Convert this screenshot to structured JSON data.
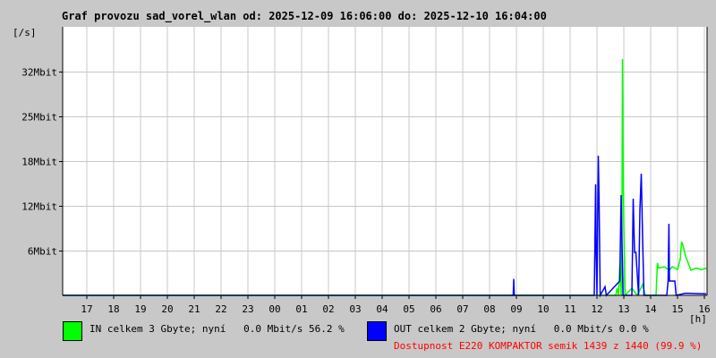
{
  "title": "Graf provozu sad_vorel_wlan od: 2025-12-09 16:06:00 do: 2025-12-10 16:04:00",
  "legend": {
    "in_text": "IN celkem 3 Gbyte; nyní   0.0 Mbit/s 56.2 %",
    "out_text": "OUT celkem 2 Gbyte; nyní   0.0 Mbit/s 0.0 %",
    "availability": "Dostupnost E220 KOMPAKTOR semik 1439 z 1440 (99.9 %)"
  },
  "colors": {
    "in": "#00ff00",
    "out": "#0000ff",
    "availability": "#ff0000",
    "grid": "#c8c8c8"
  },
  "chart_data": {
    "type": "line",
    "ylabel": "[/s]",
    "xlabel": "[h]",
    "ylim": [
      0,
      37.5
    ],
    "yticks": [
      {
        "v": 6.25,
        "label": "6Mbit"
      },
      {
        "v": 12.5,
        "label": "12Mbit"
      },
      {
        "v": 18.75,
        "label": "18Mbit"
      },
      {
        "v": 25,
        "label": "25Mbit"
      },
      {
        "v": 31.25,
        "label": "32Mbit"
      }
    ],
    "xlim": [
      16.1,
      40.07
    ],
    "xticks": [
      "17",
      "18",
      "19",
      "20",
      "21",
      "22",
      "23",
      "00",
      "01",
      "02",
      "03",
      "04",
      "05",
      "06",
      "07",
      "08",
      "09",
      "10",
      "11",
      "12",
      "13",
      "14",
      "15",
      "16"
    ],
    "series": [
      {
        "name": "IN",
        "color": "#00ff00",
        "points": [
          [
            36.5,
            0
          ],
          [
            36.7,
            0
          ],
          [
            36.75,
            1
          ],
          [
            36.8,
            0
          ],
          [
            36.85,
            4
          ],
          [
            36.9,
            0
          ],
          [
            36.93,
            9
          ],
          [
            36.95,
            33
          ],
          [
            36.97,
            20
          ],
          [
            37.0,
            10
          ],
          [
            37.05,
            0
          ],
          [
            37.3,
            1
          ],
          [
            37.5,
            0
          ],
          [
            37.7,
            1.5
          ],
          [
            37.8,
            0
          ],
          [
            38.2,
            0
          ],
          [
            38.25,
            4.5
          ],
          [
            38.3,
            3.8
          ],
          [
            38.5,
            4
          ],
          [
            38.7,
            3.5
          ],
          [
            38.8,
            4
          ],
          [
            39.0,
            3.6
          ],
          [
            39.1,
            5
          ],
          [
            39.15,
            7.5
          ],
          [
            39.2,
            7
          ],
          [
            39.3,
            5.5
          ],
          [
            39.4,
            4.5
          ],
          [
            39.5,
            3.5
          ],
          [
            39.7,
            3.8
          ],
          [
            39.9,
            3.6
          ],
          [
            40.07,
            3.8
          ]
        ]
      },
      {
        "name": "OUT",
        "color": "#0000ff",
        "points": [
          [
            32.88,
            0
          ],
          [
            32.9,
            2.3
          ],
          [
            32.92,
            0
          ],
          [
            35.9,
            0
          ],
          [
            35.95,
            15.5
          ],
          [
            35.97,
            6
          ],
          [
            36.0,
            0
          ],
          [
            36.05,
            19.5
          ],
          [
            36.08,
            13
          ],
          [
            36.12,
            0
          ],
          [
            36.3,
            1.2
          ],
          [
            36.35,
            0
          ],
          [
            36.85,
            2
          ],
          [
            36.9,
            14
          ],
          [
            36.93,
            8
          ],
          [
            36.97,
            0
          ],
          [
            37.3,
            0
          ],
          [
            37.35,
            13.5
          ],
          [
            37.4,
            6
          ],
          [
            37.45,
            6
          ],
          [
            37.55,
            0
          ],
          [
            37.6,
            12
          ],
          [
            37.65,
            17
          ],
          [
            37.7,
            8
          ],
          [
            37.75,
            0
          ],
          [
            38.6,
            0
          ],
          [
            38.65,
            2
          ],
          [
            38.68,
            10
          ],
          [
            38.7,
            2
          ],
          [
            38.9,
            2
          ],
          [
            38.95,
            0
          ],
          [
            39.3,
            0.3
          ],
          [
            40.07,
            0.2
          ]
        ]
      }
    ]
  }
}
